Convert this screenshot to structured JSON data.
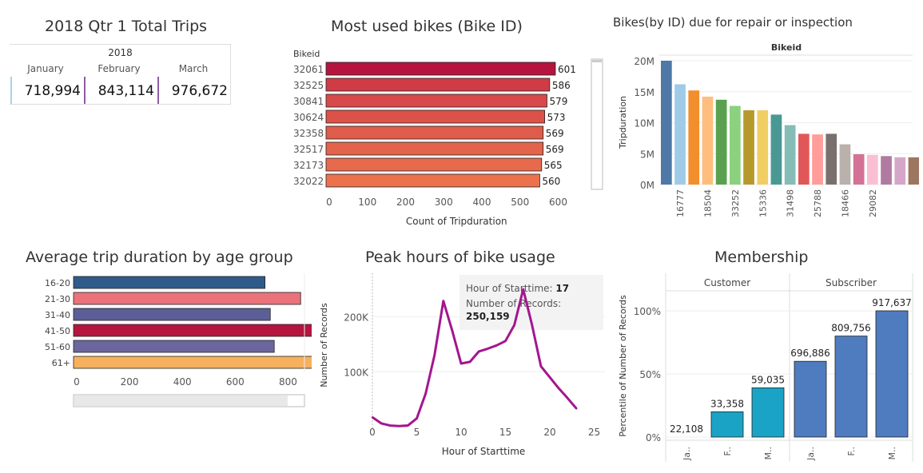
{
  "dashboard": {
    "kpi": {
      "title": "2018 Qtr 1 Total Trips",
      "year": "2018",
      "months": [
        "January",
        "February",
        "March"
      ],
      "values": [
        "718,994",
        "843,114",
        "976,672"
      ]
    },
    "tooltip": {
      "hour_label": "Hour of Starttime:",
      "hour_value": "17",
      "count_label": "Number of Records:",
      "count_value": "250,159"
    }
  },
  "chart_data": [
    {
      "id": "most_used",
      "type": "bar",
      "orientation": "horizontal",
      "title": "Most used bikes (Bike ID)",
      "category_header": "Bikeid",
      "categories": [
        "32061",
        "32525",
        "30841",
        "30624",
        "32358",
        "32517",
        "32173",
        "32022"
      ],
      "values": [
        601,
        586,
        579,
        573,
        569,
        569,
        565,
        560
      ],
      "xlabel": "Count of Tripduration",
      "xlim": [
        0,
        650
      ],
      "ticks": [
        0,
        100,
        200,
        300,
        400,
        500,
        600
      ],
      "colors": [
        "#b5143f",
        "#cf3c45",
        "#d8494b",
        "#dc5249",
        "#e05c4a",
        "#e4634b",
        "#e86a4c",
        "#ec724d"
      ]
    },
    {
      "id": "repair",
      "type": "bar",
      "title": "Bikes(by ID) due for repair or inspection",
      "header": "Bikeid",
      "ylabel": "Tripduration",
      "ylim": [
        0,
        21000000
      ],
      "yticks": [
        0,
        5000000,
        10000000,
        15000000,
        20000000
      ],
      "ytick_labels": [
        "0M",
        "5M",
        "10M",
        "15M",
        "20M"
      ],
      "x_labels": [
        "16777",
        "18504",
        "33252",
        "15336",
        "31498",
        "25788",
        "18466",
        "29082"
      ],
      "values": [
        20000000,
        16200000,
        15200000,
        14200000,
        13700000,
        12700000,
        12000000,
        12000000,
        11300000,
        9600000,
        8200000,
        8100000,
        8200000,
        6500000,
        4900000,
        4800000,
        4600000,
        4400000,
        4400000
      ],
      "colors": [
        "#4e79a7",
        "#a0cbe8",
        "#f28e2b",
        "#ffbe7d",
        "#59a14f",
        "#8cd17d",
        "#b6992d",
        "#f1ce63",
        "#499894",
        "#86bcb6",
        "#e15759",
        "#ff9d9a",
        "#79706e",
        "#bab0ac",
        "#d37295",
        "#fabfd2",
        "#b07aa1",
        "#d4a6c8",
        "#9d7660"
      ]
    },
    {
      "id": "age",
      "type": "bar",
      "orientation": "horizontal",
      "title": "Average trip duration by age group",
      "categories": [
        "16-20",
        "21-30",
        "31-40",
        "41-50",
        "51-60",
        "61+"
      ],
      "values": [
        725,
        860,
        745,
        1080,
        760,
        905
      ],
      "xlim": [
        0,
        1080
      ],
      "ticks": [
        0,
        200,
        400,
        600,
        800,
        1000
      ],
      "colors": [
        "#2f5b8a",
        "#ea737b",
        "#5c5f96",
        "#b5143f",
        "#6c669e",
        "#f7b05e"
      ]
    },
    {
      "id": "peak",
      "type": "line",
      "title": "Peak hours of bike usage",
      "xlabel": "Hour of Starttime",
      "ylabel": "Number of Records",
      "x": [
        0,
        1,
        2,
        3,
        4,
        5,
        6,
        7,
        8,
        9,
        10,
        11,
        12,
        13,
        14,
        15,
        16,
        17,
        18,
        19,
        20,
        21,
        22,
        23
      ],
      "y": [
        17000,
        6000,
        2000,
        1000,
        2000,
        15000,
        60000,
        130000,
        229000,
        175000,
        115000,
        118000,
        137000,
        142000,
        148000,
        156000,
        185000,
        250159,
        185000,
        110000,
        90000,
        70000,
        52000,
        33000
      ],
      "xlim": [
        0,
        25
      ],
      "ylim": [
        0,
        255000
      ],
      "xticks": [
        0,
        5,
        10,
        15,
        20,
        25
      ],
      "yticks": [
        100000,
        200000
      ],
      "ytick_labels": [
        "100K",
        "200K"
      ],
      "color": "#a3168f"
    },
    {
      "id": "membership",
      "type": "bar",
      "title": "Membership",
      "ylabel": "Percentile of Number of Records",
      "groups": [
        {
          "name": "Customer",
          "categories": [
            "Ja..",
            "F..",
            "M.."
          ],
          "labels": [
            "22,108",
            "33,358",
            "59,035"
          ],
          "percentiles": [
            0,
            20,
            39
          ]
        },
        {
          "name": "Subscriber",
          "categories": [
            "Ja..",
            "F..",
            "M.."
          ],
          "labels": [
            "696,886",
            "809,756",
            "917,637"
          ],
          "percentiles": [
            60,
            80,
            100
          ]
        }
      ],
      "ylim": [
        0,
        112
      ],
      "yticks": [
        0,
        50,
        100
      ],
      "ytick_labels": [
        "0%",
        "50%",
        "100%"
      ],
      "colors": {
        "Customer": "#1ba3c6",
        "Subscriber": "#4f7bbf"
      }
    }
  ]
}
